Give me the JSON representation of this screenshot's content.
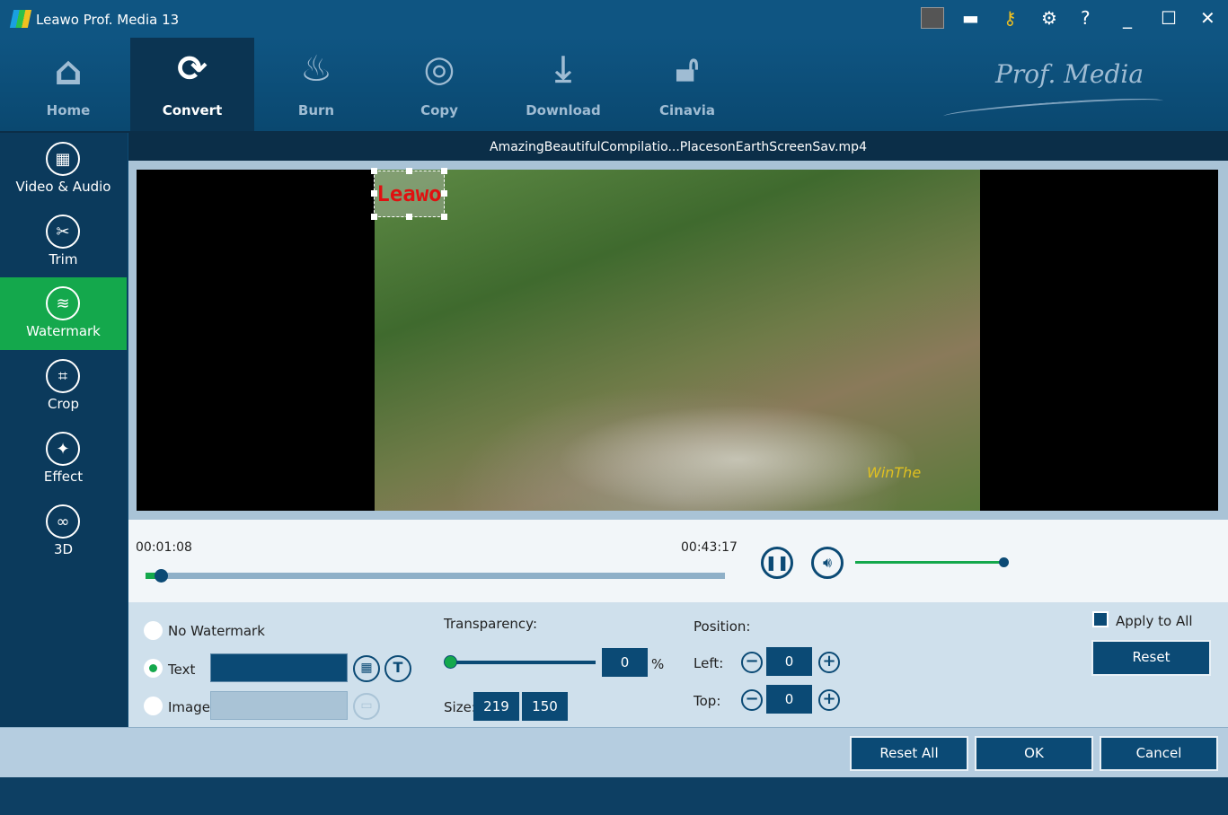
{
  "app": {
    "title": "Leawo Prof. Media 13",
    "brand": "Prof. Media"
  },
  "toolbar": [
    {
      "label": "Home",
      "icon": "home-icon"
    },
    {
      "label": "Convert",
      "icon": "convert-icon"
    },
    {
      "label": "Burn",
      "icon": "burn-icon"
    },
    {
      "label": "Copy",
      "icon": "copy-icon"
    },
    {
      "label": "Download",
      "icon": "download-icon"
    },
    {
      "label": "Cinavia",
      "icon": "cinavia-icon"
    }
  ],
  "sidebar": [
    {
      "label": "Video & Audio",
      "icon": "film-icon"
    },
    {
      "label": "Trim",
      "icon": "scissors-icon"
    },
    {
      "label": "Watermark",
      "icon": "watermark-icon"
    },
    {
      "label": "Crop",
      "icon": "crop-icon"
    },
    {
      "label": "Effect",
      "icon": "effect-icon"
    },
    {
      "label": "3D",
      "icon": "3d-glasses-icon"
    }
  ],
  "file": {
    "name": "AmazingBeautifulCompilatio...PlacesonEarthScreenSav.mp4"
  },
  "preview": {
    "watermark_text": "Leawo",
    "corner_logo": "WinThe"
  },
  "player": {
    "current": "00:01:08",
    "total": "00:43:17",
    "progress": 0.027,
    "volume": 1.0
  },
  "options": {
    "no_watermark": "No Watermark",
    "text": "Text",
    "image": "Image",
    "text_value": "",
    "transparency_label": "Transparency:",
    "transparency": "0",
    "percent": "%",
    "size_label": "Size:",
    "width": "219",
    "height": "150",
    "position_label": "Position:",
    "left_label": "Left:",
    "left": "0",
    "top_label": "Top:",
    "top": "0",
    "apply_all": "Apply to All",
    "reset": "Reset"
  },
  "buttons": {
    "reset_all": "Reset All",
    "ok": "OK",
    "cancel": "Cancel"
  },
  "colors": {
    "accent": "#14a84c",
    "primary": "#0b4a75"
  }
}
